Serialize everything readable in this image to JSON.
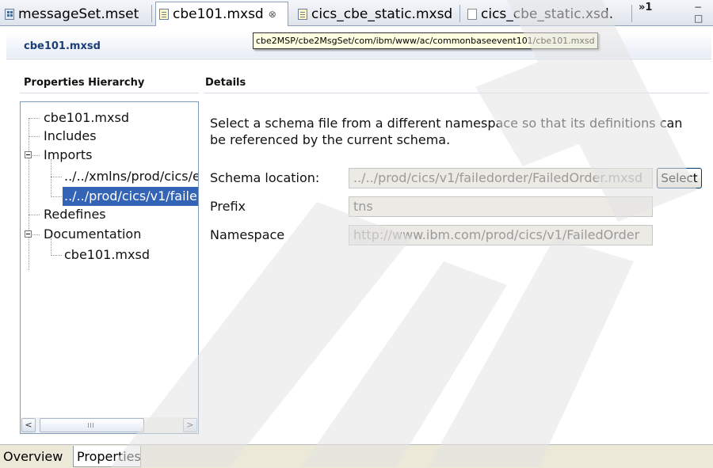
{
  "tabs": [
    {
      "label": "messageSet.mset",
      "icon": "message-set-icon",
      "active": false
    },
    {
      "label": "cbe101.mxsd",
      "icon": "schema-file-icon",
      "active": true,
      "close": "⊗"
    },
    {
      "label": "cics_cbe_static.mxsd",
      "icon": "schema-file-icon",
      "active": false
    },
    {
      "label": "cics_cbe_static.xsd.",
      "icon": "xsd-file-icon",
      "active": false
    }
  ],
  "tab_overflow": "»1",
  "window_controls": "− □",
  "editor": {
    "title": "cbe101.mxsd",
    "tooltip": "cbe2MSP/cbe2MsgSet/com/ibm/www/ac/commonbaseevent101/cbe101.mxsd"
  },
  "hierarchy": {
    "title": "Properties Hierarchy",
    "items": [
      {
        "label": "cbe101.mxsd"
      },
      {
        "label": "Includes"
      },
      {
        "label": "Imports",
        "expanded": true
      },
      {
        "label": "../../xmlns/prod/cics/e"
      },
      {
        "label": "../../prod/cics/v1/faile",
        "selected": true
      },
      {
        "label": "Redefines"
      },
      {
        "label": "Documentation",
        "expanded": true
      },
      {
        "label": "cbe101.mxsd"
      }
    ]
  },
  "details": {
    "title": "Details",
    "description": "Select a schema file from a different namespace so that its definitions can be referenced by the current schema.",
    "schema_location": {
      "label": "Schema location:",
      "value": "../../prod/cics/v1/failedorder/FailedOrder.mxsd"
    },
    "select_label": "Select",
    "prefix": {
      "label": "Prefix",
      "value": "tns"
    },
    "namespace": {
      "label": "Namespace",
      "value": "http://www.ibm.com/prod/cics/v1/FailedOrder"
    }
  },
  "scrollbar": {
    "left_arrow": "<",
    "right_arrow": ">"
  },
  "bottom_tabs": [
    {
      "label": "Overview",
      "active": false
    },
    {
      "label": "Properties",
      "active": true
    }
  ],
  "colors": {
    "selection": "#3464b5",
    "title_blue": "#1b3e78",
    "watermark": "#e4e4e4"
  }
}
